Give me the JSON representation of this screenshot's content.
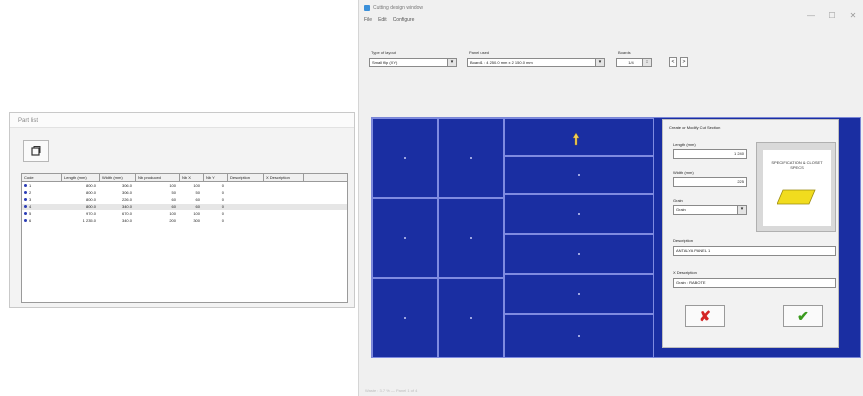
{
  "parts_window": {
    "title": "Part list",
    "refresh_icon": "refresh-icon",
    "columns": [
      "Code",
      "Length (mm)",
      "Width (mm)",
      "Nb produced",
      "Nb X",
      "Nb Y",
      "Description",
      "X Description"
    ],
    "rows": [
      {
        "code": "1",
        "length": "800.0",
        "width": "306.0",
        "produced": "100",
        "nbx": "100",
        "nby": "0",
        "selected": false
      },
      {
        "code": "2",
        "length": "800.0",
        "width": "306.0",
        "produced": "50",
        "nbx": "50",
        "nby": "0",
        "selected": false
      },
      {
        "code": "3",
        "length": "800.0",
        "width": "226.0",
        "produced": "60",
        "nbx": "60",
        "nby": "0",
        "selected": false
      },
      {
        "code": "4",
        "length": "800.0",
        "width": "340.0",
        "produced": "60",
        "nbx": "60",
        "nby": "0",
        "selected": true
      },
      {
        "code": "5",
        "length": "970.0",
        "width": "670.0",
        "produced": "100",
        "nbx": "100",
        "nby": "0",
        "selected": false
      },
      {
        "code": "6",
        "length": "1 235.0",
        "width": "340.0",
        "produced": "200",
        "nbx": "300",
        "nby": "0",
        "selected": false
      }
    ]
  },
  "main_window": {
    "title": "Cutting design window",
    "controls": {
      "minimize": "—",
      "maximize": "☐",
      "close": "✕"
    },
    "menu": [
      "File",
      "Edit",
      "Configure"
    ],
    "layout_type_label": "Type of layout",
    "layout_type_value": "Small flip (XY)",
    "panel_used_label": "Panel used",
    "panel_used_value": "Board1 : 4 250.0 mm x 2 150.0 mm",
    "boards_label": "Boards",
    "boards_value": "1/4",
    "prev": "<",
    "next": ">",
    "status": "Waste : 3.7 % — Panel 1 of 4"
  },
  "dialog": {
    "title": "Create or Modify Cut Section",
    "length_label": "Length (mm)",
    "length_value": "1 240",
    "width_label": "Width (mm)",
    "width_value": "225",
    "grain_label": "Grain",
    "grain_value": "Grain",
    "description_label": "Description",
    "description_value": "ANTALYA PANEL 1",
    "x_description_label": "X Description",
    "x_description_value": "Grain : RABOTE",
    "preview_text": "SPECIFICATION & CLOSET SPECS",
    "cancel_icon": "cancel-x-icon",
    "ok_icon": "checkmark-icon",
    "colors": {
      "cancel": "#d42424",
      "ok": "#3a9a1e",
      "preview_shape": "#f1dc1e"
    }
  },
  "colors": {
    "board": "#1a2ea2",
    "piece_line": "#7f8be0"
  }
}
